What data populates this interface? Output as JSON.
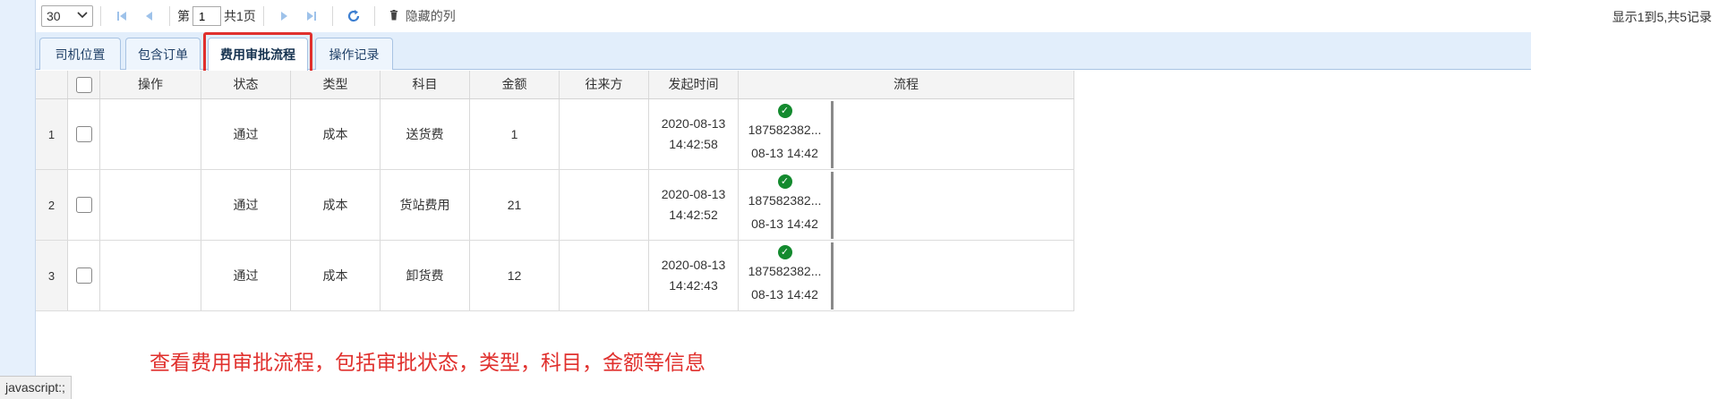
{
  "toolbar": {
    "page_size": "30",
    "page_prefix": "第",
    "page_number": "1",
    "page_total": "共1页",
    "hidden_columns_label": "隐藏的列",
    "record_info": "显示1到5,共5记录"
  },
  "tabs": [
    {
      "label": "司机位置",
      "active": false
    },
    {
      "label": "包含订单",
      "active": false
    },
    {
      "label": "费用审批流程",
      "active": true
    },
    {
      "label": "操作记录",
      "active": false
    }
  ],
  "table": {
    "columns": [
      "操作",
      "状态",
      "类型",
      "科目",
      "金额",
      "往来方",
      "发起时间",
      "流程"
    ],
    "rows": [
      {
        "num": "1",
        "status": "通过",
        "type": "成本",
        "subject": "送货费",
        "amount": "1",
        "counterparty": "",
        "date": "2020-08-13",
        "time": "14:42:58",
        "flow_phone": "187582382...",
        "flow_time": "08-13 14:42"
      },
      {
        "num": "2",
        "status": "通过",
        "type": "成本",
        "subject": "货站费用",
        "amount": "21",
        "counterparty": "",
        "date": "2020-08-13",
        "time": "14:42:52",
        "flow_phone": "187582382...",
        "flow_time": "08-13 14:42"
      },
      {
        "num": "3",
        "status": "通过",
        "type": "成本",
        "subject": "卸货费",
        "amount": "12",
        "counterparty": "",
        "date": "2020-08-13",
        "time": "14:42:43",
        "flow_phone": "187582382...",
        "flow_time": "08-13 14:42"
      }
    ]
  },
  "annotation": "查看费用审批流程，包括审批状态，类型，科目，金额等信息",
  "status_bar": "javascript:;",
  "colors": {
    "accent_red": "#e0302d",
    "tab_bg": "#e2eefb",
    "nav_icon_blue": "#4a90d9",
    "approved_green": "#138a2e"
  },
  "icons": [
    "first-page-icon",
    "prev-page-icon",
    "next-page-icon",
    "last-page-icon",
    "refresh-icon",
    "trash-icon",
    "check-circle-icon",
    "chevron-down-icon"
  ]
}
